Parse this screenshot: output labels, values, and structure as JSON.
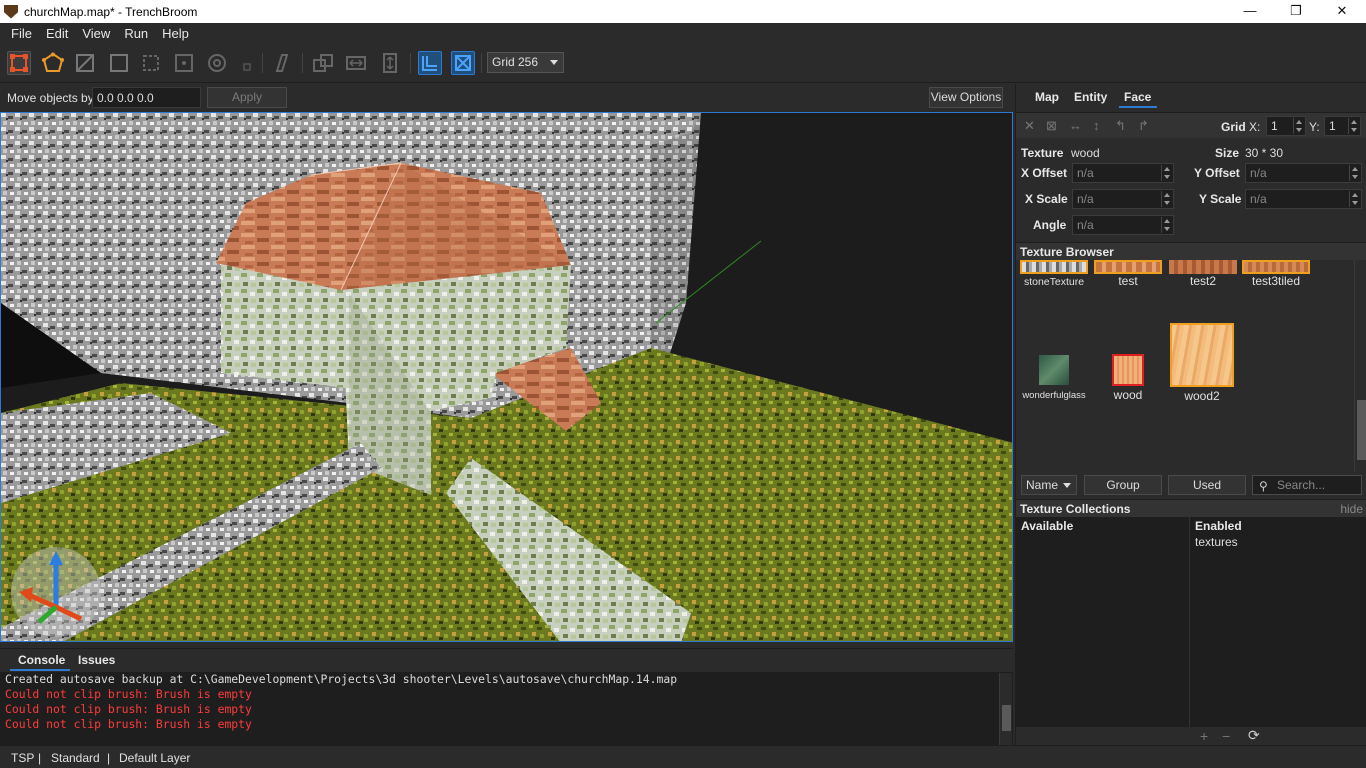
{
  "window": {
    "title": "churchMap.map* - TrenchBroom",
    "minimize": "—",
    "maximize": "❐",
    "close": "✕"
  },
  "menu": [
    "File",
    "Edit",
    "View",
    "Run",
    "Help"
  ],
  "toolbar": {
    "grid_label": "Grid 256"
  },
  "move": {
    "label": "Move objects by",
    "value": "0.0 0.0 0.0",
    "apply": "Apply",
    "view_options": "View Options"
  },
  "bottom": {
    "tabs": [
      "Console",
      "Issues"
    ]
  },
  "console": {
    "lines": [
      {
        "text": "Created autosave backup at C:\\GameDevelopment\\Projects\\3d shooter\\Levels\\autosave\\churchMap.14.map",
        "type": "normal"
      },
      {
        "text": "Could not clip brush: Brush is empty",
        "type": "error"
      },
      {
        "text": "Could not clip brush: Brush is empty",
        "type": "error"
      },
      {
        "text": "Could not clip brush: Brush is empty",
        "type": "error"
      }
    ]
  },
  "status": {
    "mode": "TSP",
    "sep": "|",
    "style": "Standard",
    "layer": "Default Layer"
  },
  "inspector": {
    "tabs": [
      "Map",
      "Entity",
      "Face"
    ],
    "grid": {
      "label": "Grid",
      "x_label": "X:",
      "x": "1",
      "y_label": "Y:",
      "y": "1"
    },
    "texture_label": "Texture",
    "texture": "wood",
    "size_label": "Size",
    "size": "30 * 30",
    "x_offset_label": "X Offset",
    "y_offset_label": "Y Offset",
    "x_scale_label": "X Scale",
    "y_scale_label": "Y Scale",
    "angle_label": "Angle",
    "na": "n/a"
  },
  "texture_browser": {
    "title": "Texture Browser",
    "row1": [
      "stoneTexture",
      "test",
      "test2",
      "test3tiled"
    ],
    "row2": [
      "wonderfulglass",
      "wood",
      "wood2"
    ],
    "sort": "Name",
    "group": "Group",
    "used": "Used",
    "search_placeholder": "Search..."
  },
  "collections": {
    "title": "Texture Collections",
    "hide": "hide",
    "available": "Available",
    "enabled": "Enabled",
    "enabled_items": [
      "textures"
    ],
    "add": "+",
    "remove": "−",
    "refresh": "⟳"
  }
}
